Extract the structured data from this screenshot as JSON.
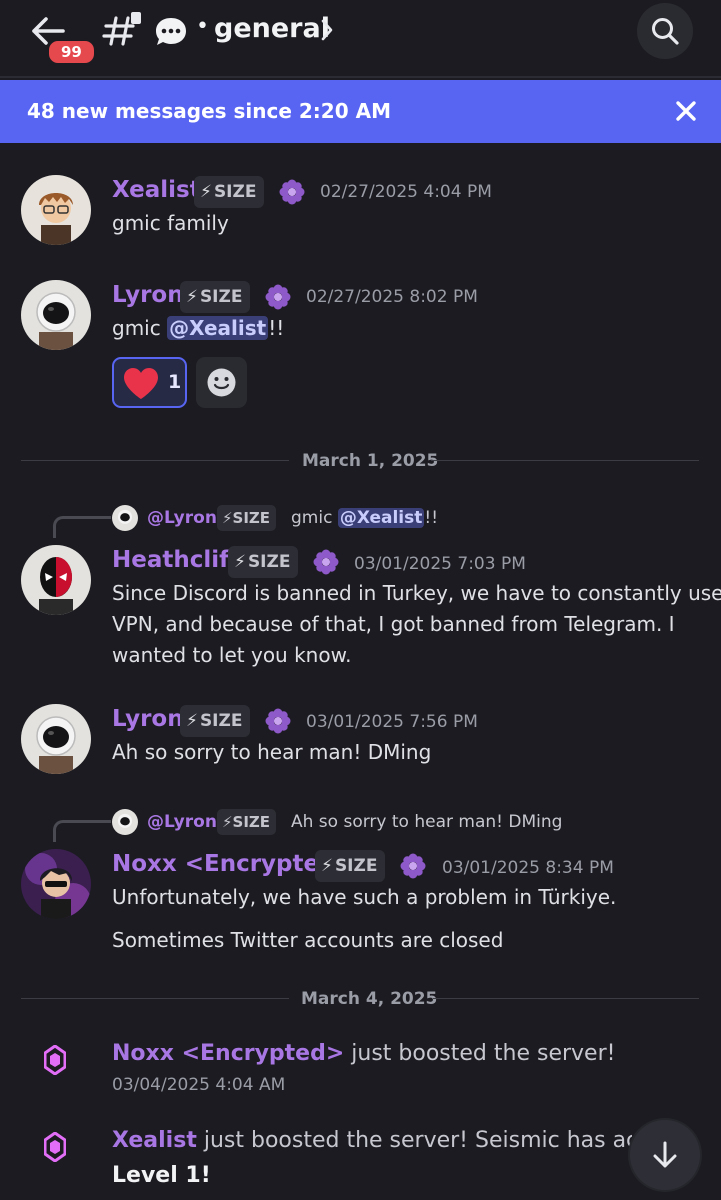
{
  "header": {
    "unread_badge": "99",
    "channel_dot": "•",
    "channel_name": "general"
  },
  "banner": {
    "text": "48 new messages since 2:20 AM"
  },
  "tag_label": "SIZE",
  "tag_bolt": "⚡",
  "messages": [
    {
      "user": "Xealist",
      "time": "02/27/2025 4:04 PM",
      "text": "gmic family"
    },
    {
      "user": "Lyron",
      "time": "02/27/2025 8:02 PM",
      "text_before": "gmic ",
      "mention": "@Xealist",
      "text_after": "!!"
    }
  ],
  "reaction": {
    "emoji": "heart",
    "count": "1"
  },
  "dividers": [
    "March 1, 2025",
    "March 4, 2025"
  ],
  "replies": [
    {
      "user": "@Lyron",
      "text_before": "gmic ",
      "mention": "@Xealist",
      "text_after": "!!"
    },
    {
      "user": "@Lyron",
      "text": "Ah so sorry to hear man! DMing"
    }
  ],
  "messages2": [
    {
      "user": "Heathcliff",
      "time": "03/01/2025 7:03 PM",
      "lines": [
        "Since Discord is banned in Turkey, we have to constantly use a",
        "VPN, and because of that, I got banned from Telegram. I",
        "wanted to let you know."
      ]
    },
    {
      "user": "Lyron",
      "time": "03/01/2025 7:56 PM",
      "text": "Ah so sorry to hear man! DMing"
    },
    {
      "user": "Noxx <Encrypted>",
      "time": "03/01/2025 8:34 PM",
      "line1": "Unfortunately, we have such a problem in Türkiye.",
      "line2": "Sometimes Twitter accounts are closed"
    }
  ],
  "boosts": [
    {
      "user": "Noxx <Encrypted>",
      "text": " just boosted the server!",
      "time": "03/04/2025 4:04 AM"
    },
    {
      "user": "Xealist",
      "text": " just boosted the server! Seismic has achie",
      "level": "Level 1!"
    }
  ],
  "icons": {
    "back": "arrow-left-icon",
    "channel": "thread-hash-icon",
    "bubble": "chat-bubble-icon",
    "search": "search-icon",
    "close": "close-icon",
    "flower": "boost-badge-icon",
    "reaction": "heart-icon",
    "add_reaction": "smile-icon",
    "boost": "nitro-gem-icon",
    "scroll": "arrow-down-icon"
  },
  "colors": {
    "background": "#1b1b21",
    "banner": "#5865f2",
    "username": "#a977e3",
    "mention_bg": "#3b3f78",
    "badge": "#e5484d",
    "boost_gem": "#e26ef7"
  }
}
